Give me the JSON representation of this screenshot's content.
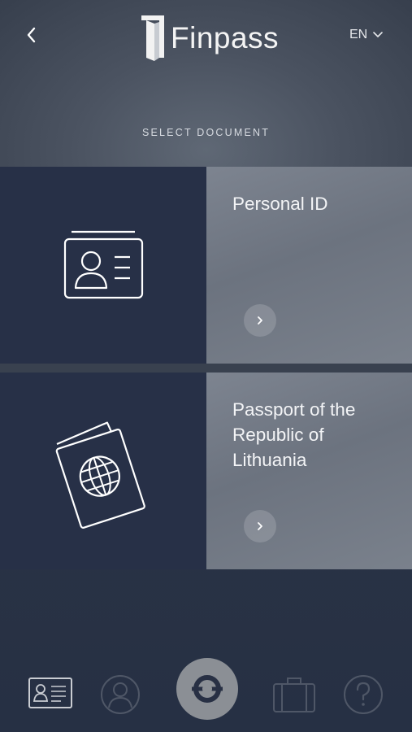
{
  "header": {
    "app_name": "Finpass",
    "language": "EN",
    "subtitle": "SELECT DOCUMENT"
  },
  "documents": [
    {
      "title": "Personal ID",
      "icon": "id-card-icon"
    },
    {
      "title": "Passport of the Republic of Lithuania",
      "icon": "passport-icon"
    }
  ],
  "nav": {
    "items": [
      {
        "name": "documents",
        "icon": "id-card-icon"
      },
      {
        "name": "profile",
        "icon": "user-icon"
      },
      {
        "name": "scan",
        "icon": "scan-icon"
      },
      {
        "name": "wallet",
        "icon": "briefcase-icon"
      },
      {
        "name": "help",
        "icon": "question-icon"
      }
    ]
  },
  "colors": {
    "card_dark": "#273047",
    "card_light": "#767d89",
    "background": "#2d3546"
  }
}
